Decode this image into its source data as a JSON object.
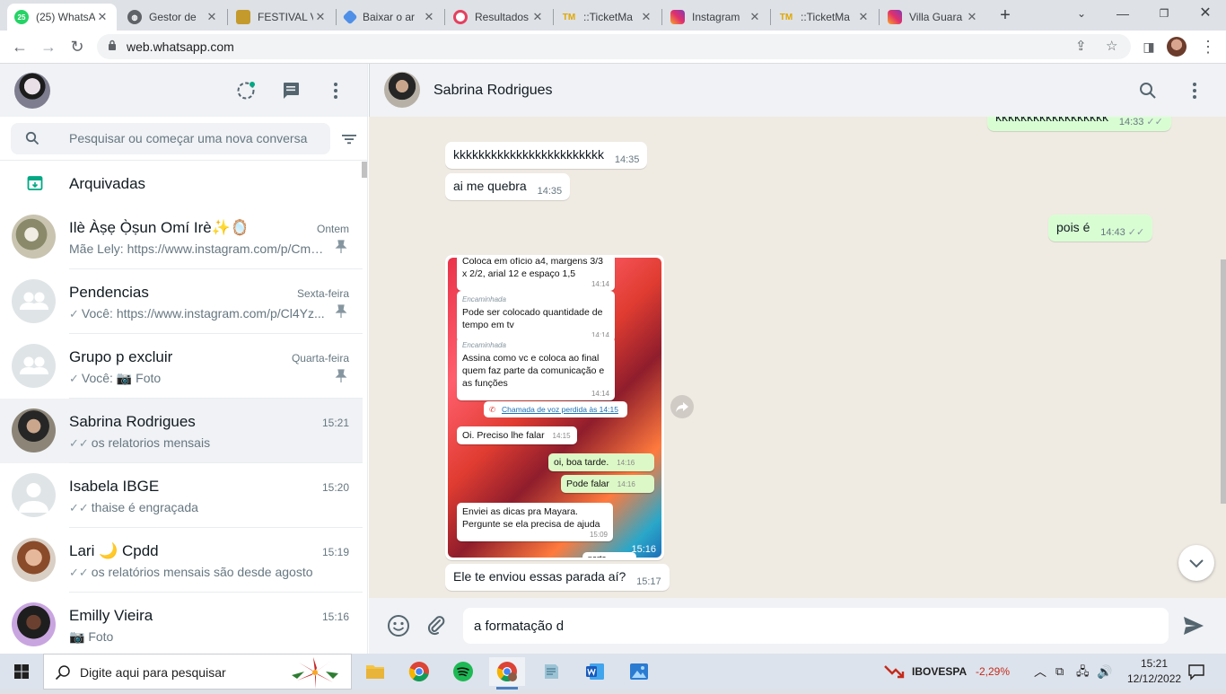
{
  "browser": {
    "tabs": [
      {
        "label": "(25) WhatsApp",
        "badge": "25",
        "active": true
      },
      {
        "label": "Gestor de",
        "active": false
      },
      {
        "label": "FESTIVAL V",
        "active": false
      },
      {
        "label": "Baixar o ar",
        "active": false
      },
      {
        "label": "Resultados",
        "active": false
      },
      {
        "label": "::TicketMa",
        "badge": "TM",
        "active": false
      },
      {
        "label": "Instagram",
        "active": false
      },
      {
        "label": "::TicketMa",
        "badge": "TM",
        "active": false
      },
      {
        "label": "Villa Guara",
        "active": false
      }
    ],
    "url": "web.whatsapp.com"
  },
  "sidebar": {
    "search_placeholder": "Pesquisar ou começar uma nova conversa",
    "archived_label": "Arquivadas",
    "chats": [
      {
        "name": "Ilè Àṣẹ Ọ̀ṣun Omí Irè✨🪞",
        "time": "Ontem",
        "preview": "Mãe Lely: https://www.instagram.com/p/CmC...",
        "pinned": true,
        "ticks": ""
      },
      {
        "name": "Pendencias",
        "time": "Sexta-feira",
        "preview": "Você: https://www.instagram.com/p/Cl4Yz...",
        "pinned": true,
        "ticks": "✓"
      },
      {
        "name": "Grupo p excluir",
        "time": "Quarta-feira",
        "preview": "Você: 📷 Foto",
        "pinned": true,
        "ticks": "✓"
      },
      {
        "name": "Sabrina  Rodrigues",
        "time": "15:21",
        "preview": "os relatorios mensais",
        "pinned": false,
        "ticks": "✓✓"
      },
      {
        "name": "Isabela IBGE",
        "time": "15:20",
        "preview": "thaise é engraçada",
        "pinned": false,
        "ticks": "✓✓"
      },
      {
        "name": "Lari 🌙 Cpdd",
        "time": "15:19",
        "preview": "os relatórios mensais são desde agosto",
        "pinned": false,
        "ticks": "✓✓"
      },
      {
        "name": "Emilly Vieira",
        "time": "15:16",
        "preview": "📷 Foto",
        "pinned": false,
        "ticks": ""
      }
    ]
  },
  "conversation": {
    "contact_name": "Sabrina  Rodrigues",
    "messages": [
      {
        "dir": "out",
        "text": "kkkkkkkkkkkkkkkkkk",
        "time": "14:33",
        "ticks": "✓✓"
      },
      {
        "dir": "in",
        "text": "kkkkkkkkkkkkkkkkkkkkkkkk",
        "time": "14:35"
      },
      {
        "dir": "in",
        "text": "ai me quebra",
        "time": "14:35"
      },
      {
        "dir": "out",
        "text": "pois é",
        "time": "14:43",
        "ticks": "✓✓"
      },
      {
        "dir": "in",
        "text": "Ele te enviou essas parada aí?",
        "time": "15:17"
      }
    ],
    "image_message": {
      "time": "15:16",
      "screenshot_messages": [
        {
          "text": "Coloca em ofício a4, margens 3/3 x 2/2, arial 12 e espaço 1,5",
          "time": "14:14",
          "forwarded": ""
        },
        {
          "text": "Pode ser colocado quantidade de tempo em tv",
          "time": "14:14",
          "forwarded": "Encaminhada"
        },
        {
          "text": "Assina como vc e coloca ao final quem faz parte da comunicação e as funções",
          "time": "14:14",
          "forwarded": "Encaminhada"
        },
        {
          "text": "Oi. Preciso lhe falar",
          "time": "14:15",
          "forwarded": ""
        },
        {
          "text": "oi, boa tarde.",
          "time": "14:16",
          "forwarded": ""
        },
        {
          "text": "Pode falar",
          "time": "14:16",
          "forwarded": ""
        },
        {
          "text": "Enviei as dicas pra Mayara. Pergunte se ela precisa de ajuda",
          "time": "15:09",
          "forwarded": ""
        }
      ],
      "missed_call": "Chamada de voz perdida às 14:15",
      "partial_text": "parte"
    },
    "composer_value": "a formatação d"
  },
  "taskbar": {
    "search_placeholder": "Digite aqui para pesquisar",
    "stock_label": "IBOVESPA",
    "stock_change": "-2,29%",
    "time": "15:21",
    "date": "12/12/2022"
  },
  "colors": {
    "wa_green": "#25d366",
    "outgoing_bubble": "#d9fdd3",
    "chat_bg": "#efeae2",
    "panel_header": "#f0f2f5",
    "stock_negative": "#c42b1c"
  }
}
